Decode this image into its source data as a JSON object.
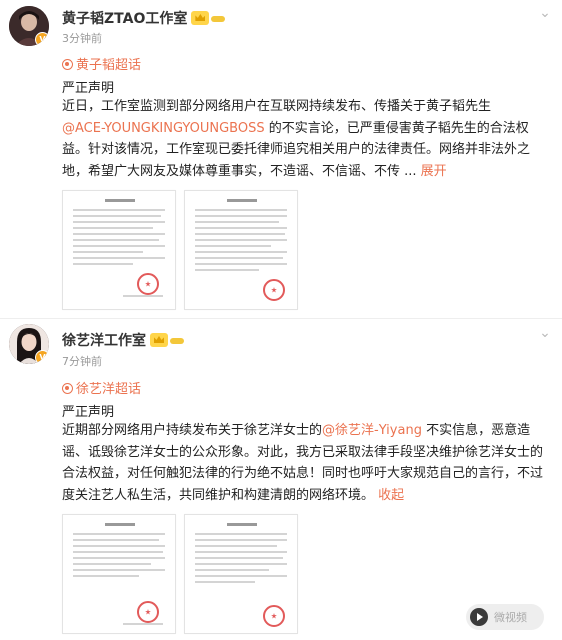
{
  "posts": [
    {
      "author": "黄子韬ZTAO工作室",
      "time": "3分钟前",
      "topic": "黄子韬超话",
      "heading": "严正声明",
      "body_pre": "近日，工作室监测到部分网络用户在互联网持续发布、传播关于黄子韬先生",
      "mention": "@ACE-YOUNGKINGYOUNGBOSS",
      "body_post": " 的不实言论，已严重侵害黄子韬先生的合法权益。针对该情况，工作室现已委托律师追究相关用户的法律责任。网络并非法外之地，希望广大网友及媒体尊重事实，不造谣、不信谣、不传 ...",
      "link": "展开",
      "images": [
        "legal-document-page-1",
        "legal-document-page-2"
      ]
    },
    {
      "author": "徐艺洋工作室",
      "time": "7分钟前",
      "topic": "徐艺洋超话",
      "heading": "严正声明",
      "body_pre": "近期部分网络用户持续发布关于徐艺洋女士的",
      "mention": "@徐艺洋-Yiyang",
      "body_post": " 不实信息，恶意造谣、诋毁徐艺洋女士的公众形象。对此，我方已采取法律手段坚决维护徐艺洋女士的合法权益，对任何触犯法律的行为绝不姑息！同时也呼吁大家规范自己的言行，不过度关注艺人私生活，共同维护和构建清朗的网络环境。",
      "link": "收起",
      "images": [
        "legal-document-page-1",
        "legal-document-page-2"
      ]
    }
  ],
  "video_button": {
    "label": "微视频"
  },
  "colors": {
    "accent": "#eb7350",
    "text": "#222222",
    "muted": "#999999",
    "seal": "#e25a5a"
  }
}
